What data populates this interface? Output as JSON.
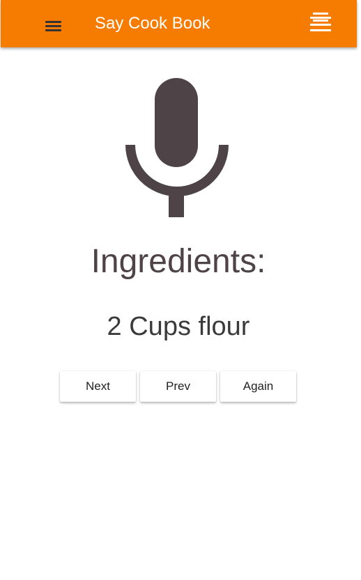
{
  "colors": {
    "toolbar": "#f57c00",
    "toolbar_text": "#ffffff",
    "icon": "#4e4346",
    "button_background": "#ffffff"
  },
  "header": {
    "title": "Say Cook Book",
    "left_icon": "menu-icon",
    "right_icon": "list-icon"
  },
  "main": {
    "mic_icon": "microphone-icon",
    "section_title": "Ingredients:",
    "current_step": "2 Cups flour"
  },
  "controls": {
    "next_label": "Next",
    "prev_label": "Prev",
    "again_label": "Again"
  }
}
